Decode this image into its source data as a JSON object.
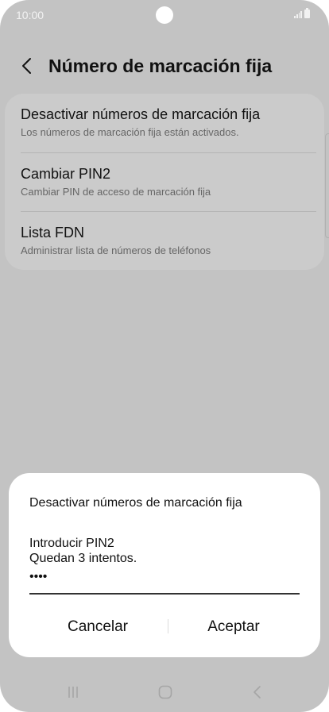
{
  "status_bar": {
    "time": "10:00"
  },
  "header": {
    "title": "Número de marcación fija"
  },
  "settings_list": [
    {
      "title": "Desactivar números de marcación fija",
      "subtitle": "Los números de marcación fija están activados."
    },
    {
      "title": "Cambiar PIN2",
      "subtitle": "Cambiar PIN de acceso de marcación fija"
    },
    {
      "title": "Lista FDN",
      "subtitle": "Administrar lista de números de teléfonos"
    }
  ],
  "dialog": {
    "title": "Desactivar números de marcación fija",
    "message_line1": "Introducir PIN2",
    "message_line2": "Quedan 3 intentos.",
    "pin_masked": "••••",
    "cancel_label": "Cancelar",
    "ok_label": "Aceptar"
  },
  "colors": {
    "background_dim": "#c3c3c3",
    "dialog_bg": "#ffffff",
    "text": "#111111"
  },
  "icons": {
    "back": "chevron-left-icon",
    "nav_recents": "recents-icon",
    "nav_home": "home-icon",
    "nav_back": "back-icon"
  }
}
